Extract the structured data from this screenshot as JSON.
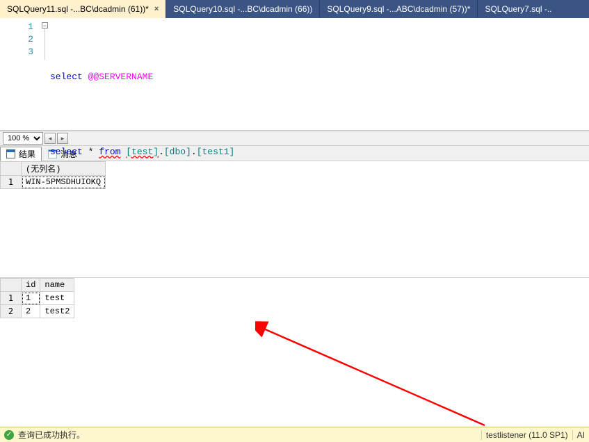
{
  "tabs": [
    {
      "label": "SQLQuery11.sql -...BC\\dcadmin (61))*",
      "active": true
    },
    {
      "label": "SQLQuery10.sql -...BC\\dcadmin (66))",
      "active": false
    },
    {
      "label": "SQLQuery9.sql -...ABC\\dcadmin (57))*",
      "active": false
    },
    {
      "label": "SQLQuery7.sql -..",
      "active": false
    }
  ],
  "close_glyph": "×",
  "fold_glyph": "−",
  "editor": {
    "lines": [
      "1",
      "2",
      "3"
    ],
    "code": {
      "l1_kw": "select",
      "l1_sys": "@@SERVERNAME",
      "l3_kw1": "select",
      "l3_star": " * ",
      "l3_kw2": "from",
      "l3_sp": " ",
      "l3_obj1": "[test]",
      "l3_dot1": ".",
      "l3_obj2": "[dbo]",
      "l3_dot2": ".",
      "l3_obj3": "[test1]"
    }
  },
  "zoom": {
    "value": "100 %"
  },
  "nav": {
    "prev": "◂",
    "next": "▸"
  },
  "results_tabs": {
    "results": "结果",
    "messages": "消息"
  },
  "grid1": {
    "header_col1": "(无列名)",
    "row1_num": "1",
    "row1_val": "WIN-5PMSDHUIOKQ"
  },
  "grid2": {
    "header_col1": "id",
    "header_col2": "name",
    "rows": [
      {
        "num": "1",
        "id": "1",
        "name": "test"
      },
      {
        "num": "2",
        "id": "2",
        "name": "test2"
      }
    ]
  },
  "status": {
    "message": "查询已成功执行。",
    "server": "testlistener (11.0 SP1)",
    "tail": "AI"
  }
}
